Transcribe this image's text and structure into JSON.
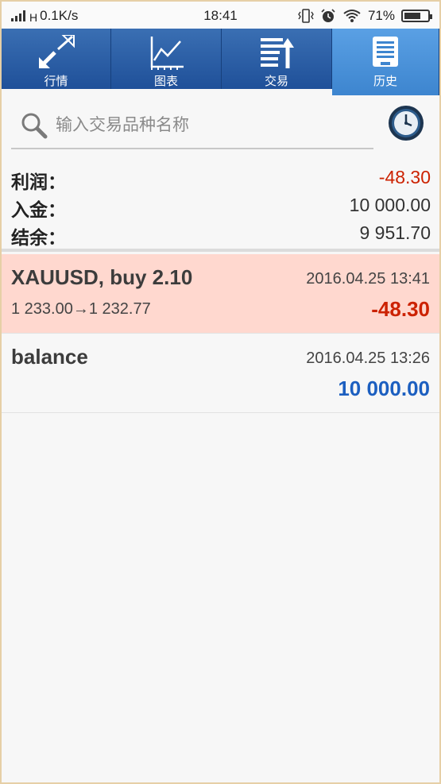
{
  "status_bar": {
    "network_type": "H",
    "speed": "0.1K/s",
    "time": "18:41",
    "battery": "71%",
    "battery_level": 0.71,
    "icons": [
      "signal-icon",
      "vibrate-icon",
      "alarm-icon",
      "wifi-icon",
      "battery-icon"
    ]
  },
  "tabs": [
    {
      "label": "行情",
      "icon": "quotes-arrows-icon",
      "active": false
    },
    {
      "label": "图表",
      "icon": "chart-icon",
      "active": false
    },
    {
      "label": "交易",
      "icon": "trade-icon",
      "active": false
    },
    {
      "label": "历史",
      "icon": "history-icon",
      "active": true
    }
  ],
  "search": {
    "placeholder": "输入交易品种名称",
    "value": ""
  },
  "summary": {
    "profit_label": "利润：",
    "profit_value": "-48.30",
    "deposit_label": "入金：",
    "deposit_value": "10 000.00",
    "balance_label": "结余：",
    "balance_value": "9 951.70"
  },
  "trades": [
    {
      "title": "XAUUSD, buy 2.10",
      "datetime": "2016.04.25 13:41",
      "prices": "1 233.00→1 232.77",
      "amount": "-48.30"
    },
    {
      "title": "balance",
      "datetime": "2016.04.25 13:26",
      "prices": "",
      "amount": "10 000.00"
    }
  ],
  "colors": {
    "tab_bg": "#1f5099",
    "tab_active_bg": "#3d85cf",
    "loss_row": "#ffd8cf",
    "negative": "#cc2200",
    "positive": "#1c5fc0"
  }
}
